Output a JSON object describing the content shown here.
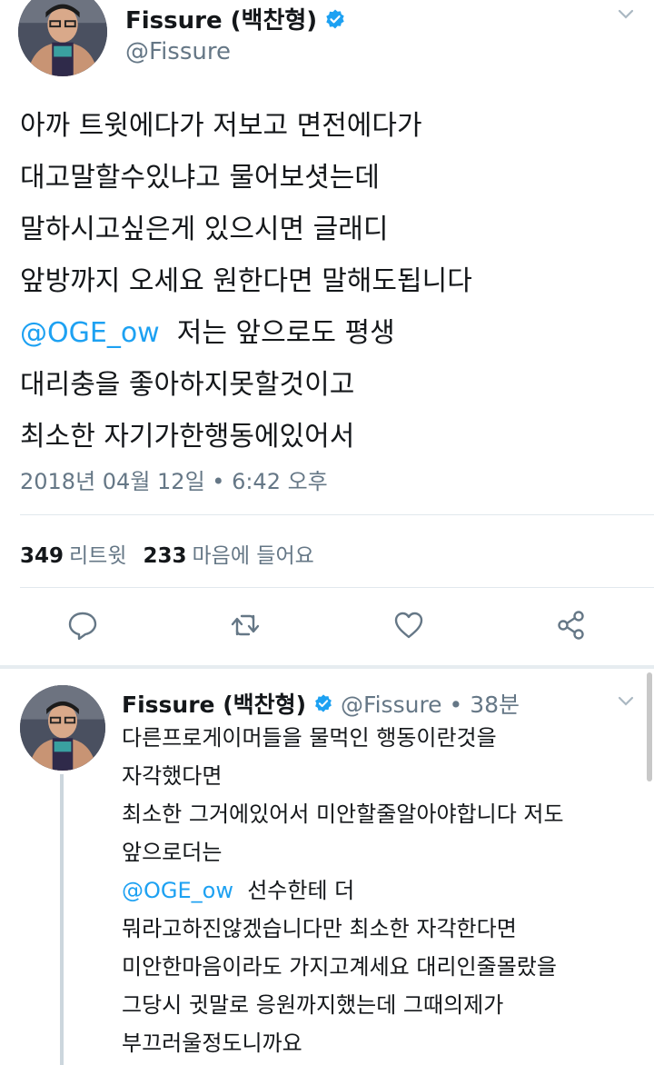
{
  "main_tweet": {
    "display_name": "Fissure (백찬형)",
    "handle": "@Fissure",
    "text_lines": [
      "아까 트윗에다가 저보고 면전에다가",
      "대고말할수있냐고 물어보셧는데",
      "말하시고싶은게 있으시면 글래디",
      "앞방까지 오세요 원한다면 말해도됩니다"
    ],
    "mention": "@OGE_ow",
    "text_after_mention": "  저는 앞으로도 평생",
    "text_lines_2": [
      "대리충을 좋아하지못할것이고",
      "최소한 자기가한행동에있어서"
    ],
    "timestamp": "2018년 04월 12일 • 6:42 오후",
    "retweet_count": "349",
    "retweet_label": "리트윗",
    "like_count": "233",
    "like_label": "마음에 들어요"
  },
  "reply_tweet": {
    "display_name": "Fissure (백찬형)",
    "handle_time": "@Fissure • 38분",
    "lines_a": [
      "다른프로게이머들을 물먹인 행동이란것을",
      "자각했다면",
      "최소한 그거에있어서 미안할줄알아야합니다 저도",
      "앞으로더는"
    ],
    "mention": "@OGE_ow",
    "text_after_mention": "  선수한테 더",
    "lines_b": [
      "뭐라고하진않겠습니다만 최소한 자각한다면",
      "미안한마음이라도 가지고계세요 대리인줄몰랐을",
      "그당시 귓말로 응원까지했는데 그때의제가",
      "부끄러울정도니까요"
    ]
  },
  "icons": {
    "actions": [
      "reply-icon",
      "retweet-icon",
      "like-icon",
      "share-icon"
    ],
    "verified": "verified-badge-icon",
    "caret": "chevron-down-icon"
  },
  "colors": {
    "link": "#1da1f2",
    "secondary": "#657786",
    "primary_text": "#14171a",
    "divider": "#e1e8ed"
  }
}
